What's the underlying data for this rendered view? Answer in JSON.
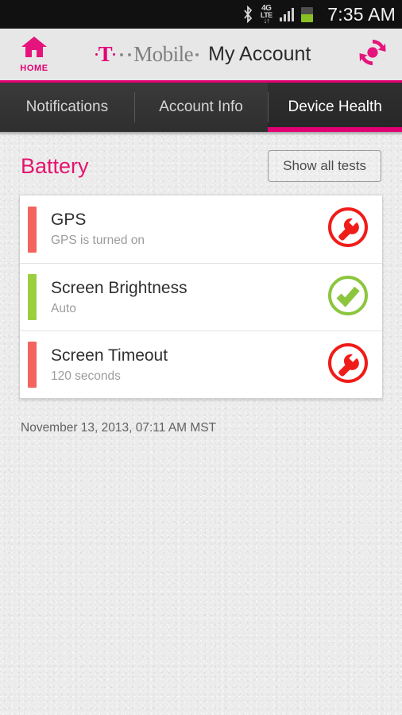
{
  "statusbar": {
    "icons": [
      "bluetooth-icon",
      "4g-lte-icon",
      "signal-icon",
      "battery-icon"
    ],
    "network_line1": "4G",
    "network_line2": "LTE",
    "network_line3": "↓↑",
    "time": "7:35 AM"
  },
  "header": {
    "home_label": "HOME",
    "brand_t": "T",
    "brand_mobile": "Mobile",
    "app_title": "My Account"
  },
  "tabs": [
    {
      "label": "Notifications",
      "active": false
    },
    {
      "label": "Account Info",
      "active": false
    },
    {
      "label": "Device Health",
      "active": true
    }
  ],
  "section": {
    "title": "Battery",
    "show_all_label": "Show all tests"
  },
  "tests": [
    {
      "title": "GPS",
      "subtitle": "GPS is turned on",
      "status": "warning",
      "status_icon": "wrench-icon",
      "accent_color": "#f4645f"
    },
    {
      "title": "Screen Brightness",
      "subtitle": "Auto",
      "status": "ok",
      "status_icon": "check-circle-icon",
      "accent_color": "#9bcf3f"
    },
    {
      "title": "Screen Timeout",
      "subtitle": "120 seconds",
      "status": "warning",
      "status_icon": "wrench-icon",
      "accent_color": "#f4645f"
    }
  ],
  "footer": {
    "timestamp": "November 13, 2013, 07:11 AM MST"
  },
  "colors": {
    "magenta": "#e20074",
    "warning_red": "#f01c19",
    "ok_green": "#8cc63e",
    "tabbar": "#343434"
  }
}
